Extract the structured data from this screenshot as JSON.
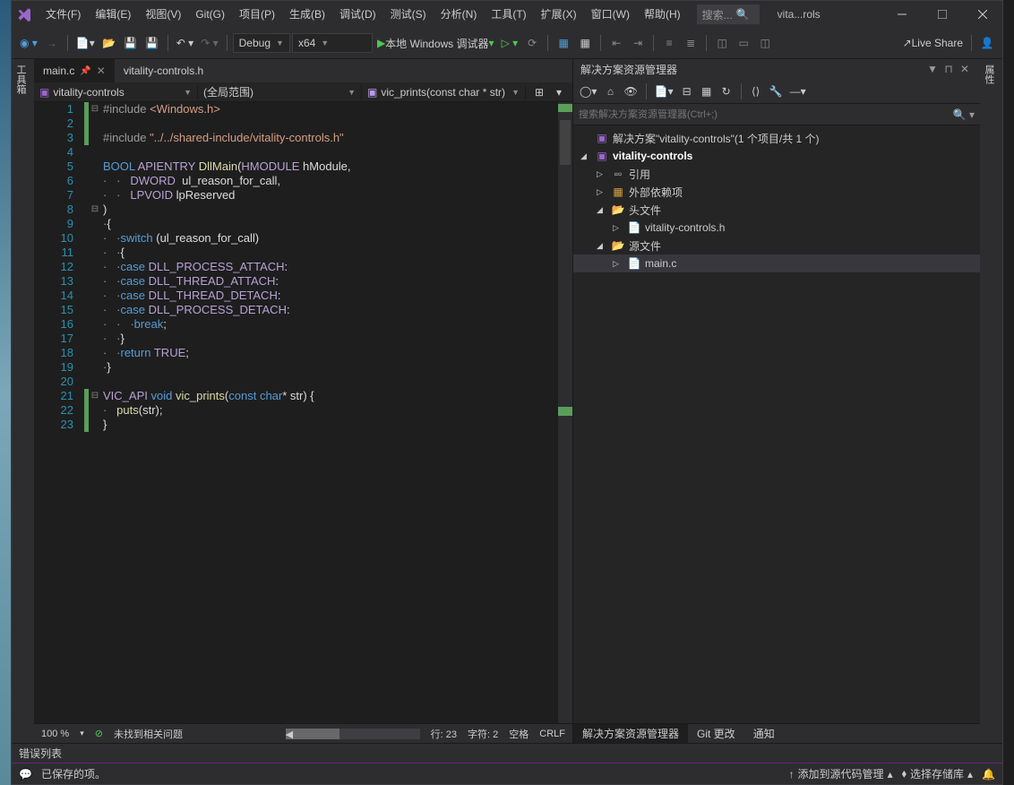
{
  "menus": [
    "文件(F)",
    "编辑(E)",
    "视图(V)",
    "Git(G)",
    "项目(P)",
    "生成(B)",
    "调试(D)",
    "测试(S)",
    "分析(N)",
    "工具(T)",
    "扩展(X)",
    "窗口(W)",
    "帮助(H)"
  ],
  "search_placeholder": "搜索...",
  "solution_title": "vita...rols",
  "toolbar": {
    "config": "Debug",
    "platform": "x64",
    "debug_target": "本地 Windows 调试器",
    "live_share": "Live Share"
  },
  "file_tabs": {
    "active": "main.c",
    "inactive": "vitality-controls.h"
  },
  "nav": {
    "project": "vitality-controls",
    "scope": "(全局范围)",
    "member": "vic_prints(const char * str)"
  },
  "code": {
    "lines": 23,
    "src": [
      {
        "n": 1,
        "fold": "⊟",
        "bar": "g",
        "html": "<span class='inc'>#include</span> <span class='str'>&lt;Windows.h&gt;</span>"
      },
      {
        "n": 2,
        "bar": "g",
        "html": ""
      },
      {
        "n": 3,
        "bar": "g",
        "html": "<span class='inc'>#include</span> <span class='str'>\"../../shared-include/vitality-controls.h\"</span>"
      },
      {
        "n": 4,
        "html": ""
      },
      {
        "n": 5,
        "html": "<span class='kw'>BOOL</span> <span class='mac'>APIENTRY</span> <span class='fn'>DllMain</span>(<span class='mac'>HMODULE</span> hModule,"
      },
      {
        "n": 6,
        "html": "<span class='com'>·   ·   </span><span class='mac'>DWORD</span>  ul_reason_for_call,"
      },
      {
        "n": 7,
        "html": "<span class='com'>·   ·   </span><span class='mac'>LPVOID</span> lpReserved"
      },
      {
        "n": 8,
        "fold": "⊟",
        "html": ")"
      },
      {
        "n": 9,
        "html": "<span class='com'>·</span>{"
      },
      {
        "n": 10,
        "html": "<span class='com'>·   ·</span><span class='kw'>switch</span> (ul_reason_for_call)"
      },
      {
        "n": 11,
        "html": "<span class='com'>·   ·</span>{"
      },
      {
        "n": 12,
        "html": "<span class='com'>·   ·</span><span class='kw'>case</span> <span class='mac'>DLL_PROCESS_ATTACH</span>:"
      },
      {
        "n": 13,
        "html": "<span class='com'>·   ·</span><span class='kw'>case</span> <span class='mac'>DLL_THREAD_ATTACH</span>:"
      },
      {
        "n": 14,
        "html": "<span class='com'>·   ·</span><span class='kw'>case</span> <span class='mac'>DLL_THREAD_DETACH</span>:"
      },
      {
        "n": 15,
        "html": "<span class='com'>·   ·</span><span class='kw'>case</span> <span class='mac'>DLL_PROCESS_DETACH</span>:"
      },
      {
        "n": 16,
        "html": "<span class='com'>·   ·   ·</span><span class='kw'>break</span>;"
      },
      {
        "n": 17,
        "html": "<span class='com'>·   ·</span>}"
      },
      {
        "n": 18,
        "html": "<span class='com'>·   ·</span><span class='kw'>return</span> <span class='mac'>TRUE</span>;"
      },
      {
        "n": 19,
        "html": "<span class='com'>·</span>}"
      },
      {
        "n": 20,
        "html": ""
      },
      {
        "n": 21,
        "fold": "⊟",
        "bar": "g",
        "html": "<span class='mac'>VIC_API</span> <span class='kw'>void</span> <span class='fn'>vic_prints</span>(<span class='kw'>const</span> <span class='kw'>char</span>* str) {"
      },
      {
        "n": 22,
        "bar": "g",
        "html": "<span class='com'>·   </span><span class='fn'>puts</span>(str);"
      },
      {
        "n": 23,
        "bar": "g",
        "html": "}"
      }
    ]
  },
  "editor_status": {
    "zoom": "100 %",
    "issues": "未找到相关问题",
    "line": "行: 23",
    "char": "字符: 2",
    "spaces": "空格",
    "crlf": "CRLF"
  },
  "solution_explorer": {
    "title": "解决方案资源管理器",
    "search_placeholder": "搜索解决方案资源管理器(Ctrl+;)",
    "root": "解决方案\"vitality-controls\"(1 个项目/共 1 个)",
    "project": "vitality-controls",
    "refs": "引用",
    "external": "外部依赖项",
    "headers": "头文件",
    "header_file": "vitality-controls.h",
    "sources": "源文件",
    "source_file": "main.c",
    "tabs": [
      "解决方案资源管理器",
      "Git 更改",
      "通知"
    ]
  },
  "left_rail": "工具箱",
  "right_rail": "属性",
  "error_list": "错误列表",
  "status_bar": {
    "saved": "已保存的项。",
    "add_source": "添加到源代码管理",
    "repo": "选择存储库"
  }
}
